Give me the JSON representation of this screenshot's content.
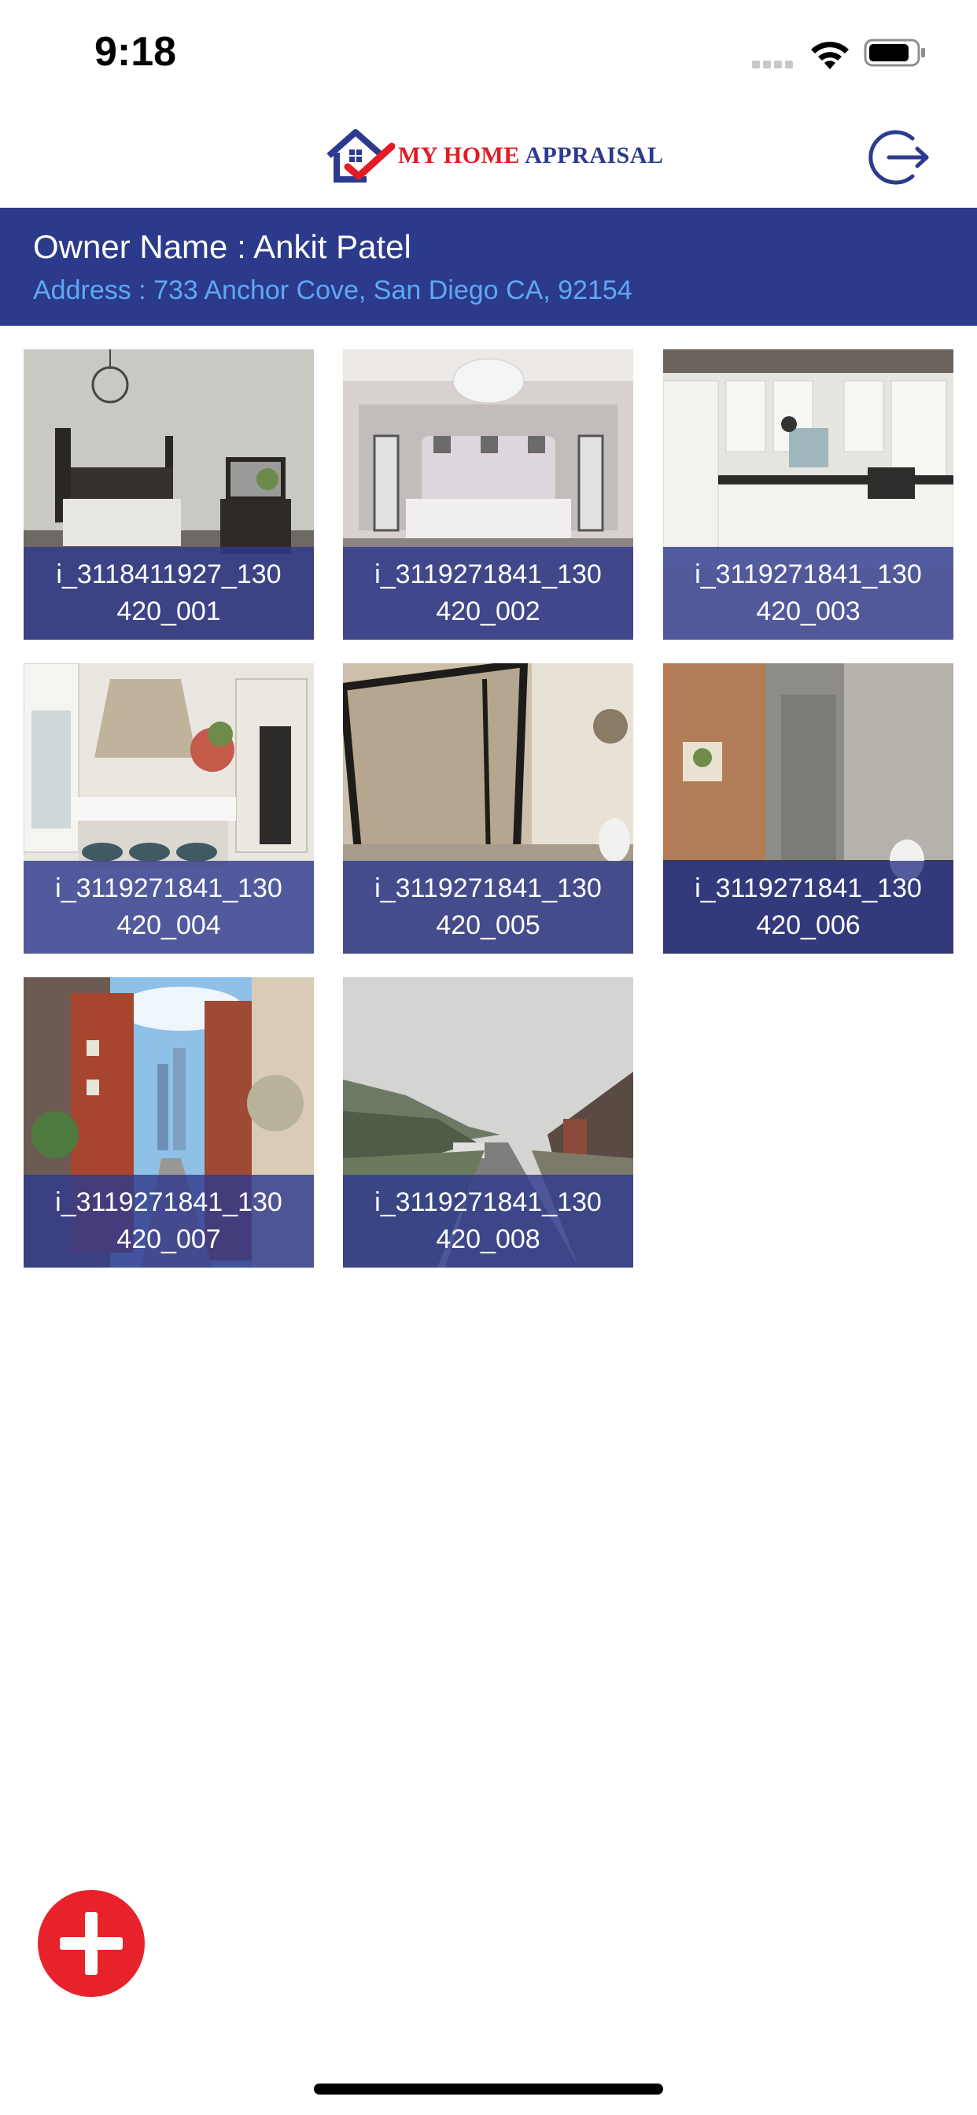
{
  "status_bar": {
    "time": "9:18",
    "icons": [
      "signal-icon",
      "wifi-icon",
      "battery-icon"
    ]
  },
  "nav": {
    "logo_text_my": "MY HOME ",
    "logo_text_appraisal": "APPRAISAL",
    "logout_icon": "logout-icon"
  },
  "owner": {
    "name_line": "Owner Name : Ankit Patel",
    "address_line": "Address : 733 Anchor Cove, San Diego CA, 92154"
  },
  "photos": [
    {
      "caption_line1": "i_3118411927_130",
      "caption_line2": "420_001",
      "scene": "bedroom-dark-furniture"
    },
    {
      "caption_line1": "i_3119271841_130",
      "caption_line2": "420_002",
      "scene": "bedroom-chandelier"
    },
    {
      "caption_line1": "i_3119271841_130",
      "caption_line2": "420_003",
      "scene": "kitchen-white"
    },
    {
      "caption_line1": "i_3119271841_130",
      "caption_line2": "420_004",
      "scene": "kitchen-island"
    },
    {
      "caption_line1": "i_3119271841_130",
      "caption_line2": "420_005",
      "scene": "bathroom-shower"
    },
    {
      "caption_line1": "i_3119271841_130",
      "caption_line2": "420_006",
      "scene": "bathroom-wood"
    },
    {
      "caption_line1": "i_3119271841_130",
      "caption_line2": "420_007",
      "scene": "street-brick"
    },
    {
      "caption_line1": "i_3119271841_130",
      "caption_line2": "420_008",
      "scene": "road-overcast"
    }
  ],
  "fab": {
    "icon": "plus-icon"
  },
  "colors": {
    "header_bg": "#2b3a8a",
    "address_text": "#5fa8f5",
    "caption_bg": "#303a8c",
    "fab": "#e8222a",
    "logo_red": "#e31b23",
    "logo_blue": "#2b3a8f"
  }
}
